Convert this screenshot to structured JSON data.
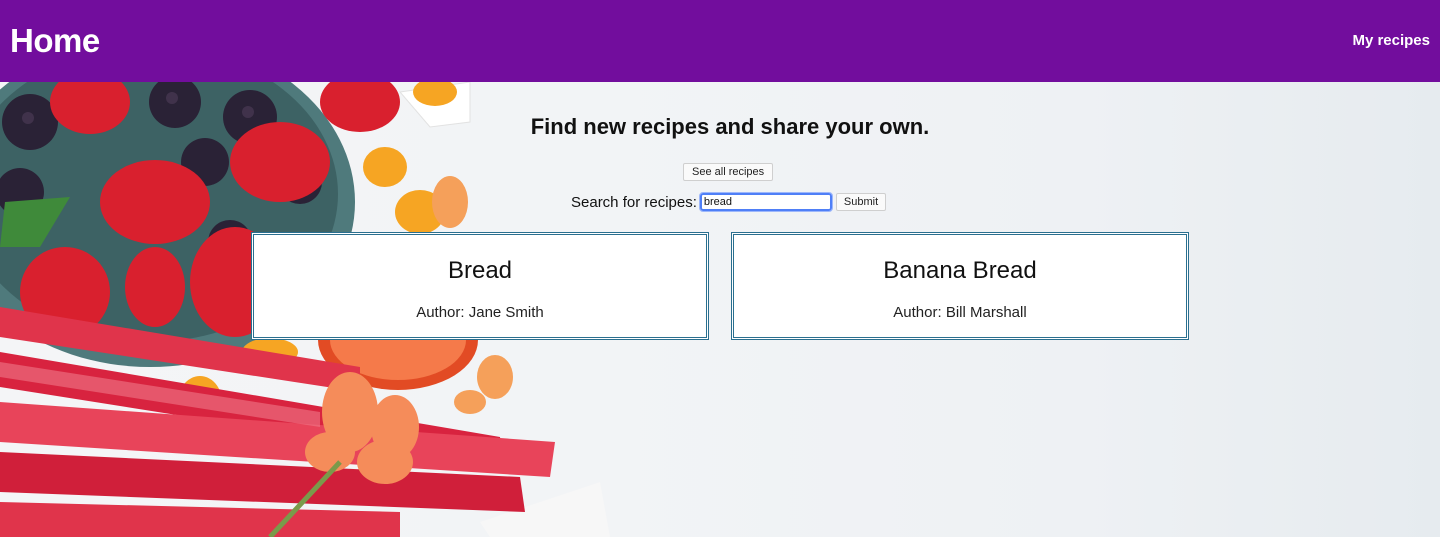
{
  "header": {
    "title": "Home",
    "nav_link": "My recipes",
    "color": "#720d9d"
  },
  "main": {
    "headline": "Find new recipes and share your own.",
    "see_all_label": "See all recipes",
    "search_label": "Search for recipes:",
    "search_value": "bread",
    "submit_label": "Submit"
  },
  "results": [
    {
      "title": "Bread",
      "author": "Author: Jane Smith"
    },
    {
      "title": "Banana Bread",
      "author": "Author: Bill Marshall"
    }
  ],
  "colors": {
    "card_border": "#2a6f8f",
    "focus_ring": "#4f7ff7"
  }
}
